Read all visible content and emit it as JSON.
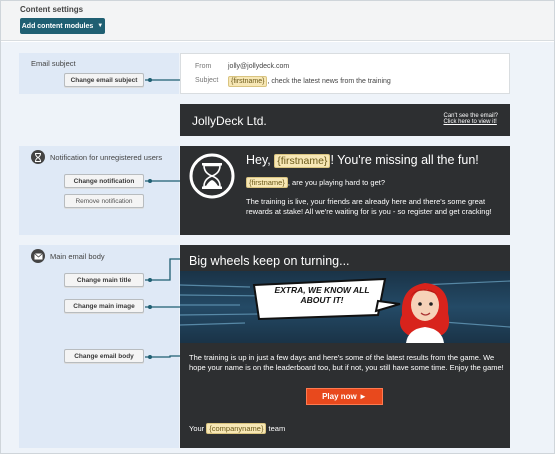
{
  "header": {
    "title": "Content settings",
    "add_button": "Add content modules"
  },
  "modules": {
    "subject": {
      "label": "Email subject",
      "change_button": "Change email subject"
    },
    "notification": {
      "label": "Notification for unregistered users",
      "change_button": "Change notification",
      "remove_button": "Remove notification",
      "icon": "hourglass-icon"
    },
    "main_body": {
      "label": "Main email body",
      "change_title_button": "Change main title",
      "change_image_button": "Change main image",
      "change_body_button": "Change email body",
      "icon": "envelope-icon"
    }
  },
  "preview": {
    "from_label": "From",
    "from_value": "jolly@jollydeck.com",
    "subject_label": "Subject",
    "subject_tag": "{firstname}",
    "subject_rest": ", check the latest news from the training",
    "company": "JollyDeck Ltd.",
    "cant_see": "Can't see the email?",
    "view_link": "Click here to view it!",
    "notif_title_pre": "Hey, ",
    "notif_title_tag": "{firstname}",
    "notif_title_post": "! You're missing all the fun!",
    "notif_line1_tag": "{firstname}",
    "notif_line1_rest": ", are you playing hard to get?",
    "notif_line2": "The training is live, your friends are already here and there's some great rewards at stake! All we're waiting for is you - so register and get cracking!",
    "main_title": "Big wheels keep on turning...",
    "banner_bubble": "EXTRA, WE KNOW ALL ABOUT IT!",
    "body_text": "The training is up in just a few days and here's some of the latest results from the game. We hope your name is on the leaderboard too, but if not, you still have some time. Enjoy the game!",
    "play_button": "Play now ►",
    "team_pre": "Your ",
    "team_tag": "{companyname}",
    "team_post": " team"
  },
  "colors": {
    "accent": "#1f5f72",
    "panel_bg": "#dfe9f6",
    "email_dark": "#2d2f31",
    "tag_bg": "#f7e7b5",
    "play_button": "#e8491d"
  }
}
